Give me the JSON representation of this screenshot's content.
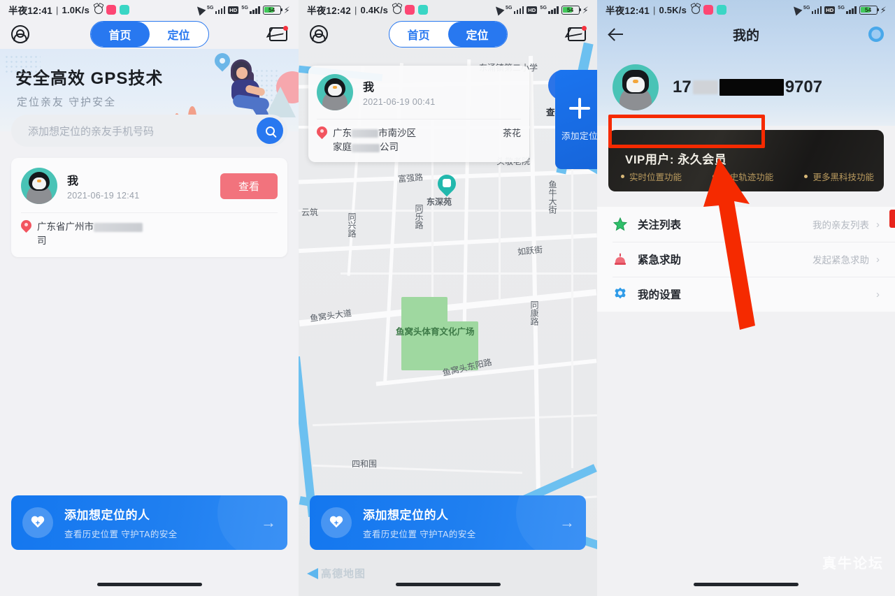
{
  "status_bars": [
    {
      "time": "半夜12:41",
      "net_speed": "1.0K/s",
      "battery": "54",
      "alarm_icon": "alarm-icon",
      "signal_5g": "5G",
      "hd_label": "HD"
    },
    {
      "time": "半夜12:42",
      "net_speed": "0.4K/s",
      "battery": "54",
      "alarm_icon": "alarm-icon",
      "signal_5g": "5G",
      "hd_label": "HD"
    },
    {
      "time": "半夜12:41",
      "net_speed": "0.5K/s",
      "battery": "54",
      "alarm_icon": "alarm-icon",
      "signal_5g": "5G",
      "hd_label": "HD"
    }
  ],
  "panel1": {
    "nav": {
      "profile_icon": "user-circle-icon",
      "mail_icon": "mail-icon",
      "tab_home": "首页",
      "tab_locate": "定位",
      "active_tab": "首页"
    },
    "hero": {
      "title": "安全高效  GPS技术",
      "subtitle": "定位亲友  守护安全"
    },
    "search": {
      "placeholder": "添加想定位的亲友手机号码",
      "button_icon": "search-icon"
    },
    "contact": {
      "name": "我",
      "time": "2021-06-19 12:41",
      "action_label": "查看",
      "address_prefix": "广东省广州市",
      "address_suffix": "司",
      "pin_icon": "location-pin-icon"
    },
    "cta": {
      "title": "添加想定位的人",
      "subtitle": "查看历史位置 守护TA的安全",
      "icon": "heart-plus-icon",
      "arrow": "→"
    }
  },
  "panel2": {
    "nav": {
      "profile_icon": "user-circle-icon",
      "mail_icon": "mail-icon",
      "tab_home": "首页",
      "tab_locate": "定位",
      "active_tab": "定位"
    },
    "card": {
      "name": "我",
      "time": "2021-06-19 00:41",
      "addr_line1_a": "广东",
      "addr_line1_b": "市南沙区",
      "addr_line2_a": "家庭",
      "addr_line2_b": "公司",
      "addr_tag": "茶花",
      "pin_icon": "location-pin-icon"
    },
    "track_button": {
      "label": "查看轨迹",
      "icon": "route-icon"
    },
    "add_button": {
      "label": "添加定位",
      "icon": "plus-icon"
    },
    "map_labels": [
      "东涌镇第二小学",
      "头敬老院",
      "富强路",
      "东深苑",
      "云筑",
      "同兴路",
      "同乐路",
      "鱼牛大街",
      "如跃街",
      "鱼窝头大道",
      "鱼窝头体育文化广场",
      "鱼窝头东阳路",
      "同康路",
      "四和围"
    ],
    "map_attribution": "高德地图",
    "cta": {
      "title": "添加想定位的人",
      "subtitle": "查看历史位置 守护TA的安全",
      "icon": "heart-plus-icon",
      "arrow": "→"
    }
  },
  "panel3": {
    "nav": {
      "back_icon": "back-arrow-icon",
      "title": "我的",
      "gear_icon": "gear-icon"
    },
    "profile": {
      "phone_prefix": "17",
      "phone_suffix": "9707",
      "avatar": "penguin-avatar"
    },
    "vip": {
      "title": "VIP用户: 永久会员",
      "features": [
        "实时位置功能",
        "历史轨迹功能",
        "更多黑科技功能"
      ],
      "highlight_color": "#f62a00"
    },
    "menu": [
      {
        "label": "关注列表",
        "value": "我的亲友列表",
        "icon": "star-icon",
        "chevron": "›"
      },
      {
        "label": "紧急求助",
        "value": "发起紧急求助",
        "icon": "alarm-bell-icon",
        "chevron": "›"
      },
      {
        "label": "我的设置",
        "value": "",
        "icon": "settings-gear-icon",
        "chevron": "›"
      }
    ],
    "watermark": "真牛论坛",
    "annotation_arrow": "red-arrow-annotation"
  }
}
